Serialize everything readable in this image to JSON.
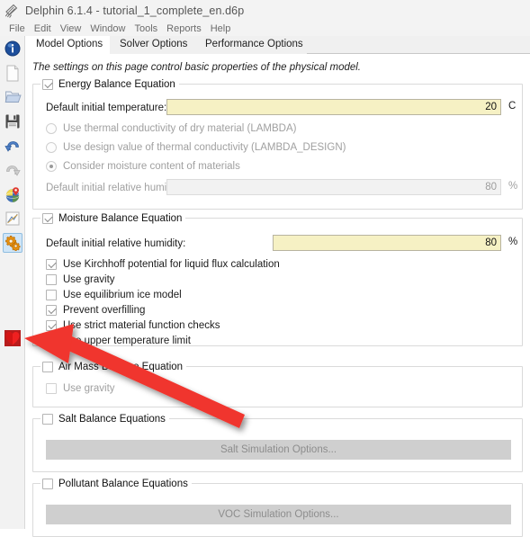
{
  "window": {
    "title": "Delphin 6.1.4 - tutorial_1_complete_en.d6p",
    "app_icon": "rain-drops-icon"
  },
  "menubar": {
    "items": [
      "File",
      "Edit",
      "View",
      "Window",
      "Tools",
      "Reports",
      "Help"
    ]
  },
  "sidebar": {
    "items": [
      {
        "name": "info-icon",
        "label": "Project Info"
      },
      {
        "name": "new-file-icon",
        "label": "New"
      },
      {
        "name": "open-folder-icon",
        "label": "Open"
      },
      {
        "name": "save-disk-icon",
        "label": "Save"
      },
      {
        "name": "undo-arrow-icon",
        "label": "Undo"
      },
      {
        "name": "redo-arrow-icon",
        "label": "Redo"
      },
      {
        "name": "globe-marker-icon",
        "label": "Climate"
      },
      {
        "name": "chart-icon",
        "label": "Outputs"
      },
      {
        "name": "gears-icon",
        "label": "Simulation Settings"
      },
      {
        "name": "red-heart-icon",
        "label": "Run Simulation"
      }
    ],
    "selected_index": 8
  },
  "tabs": [
    {
      "label": "Model Options",
      "active": true
    },
    {
      "label": "Solver Options",
      "active": false
    },
    {
      "label": "Performance Options",
      "active": false
    }
  ],
  "page": {
    "intro": "The settings on this page control basic properties of the physical model.",
    "groups": [
      {
        "id": "energy",
        "title": "Energy Balance Equation",
        "checked": true,
        "enabled": true,
        "temperature_label": "Default initial temperature:",
        "temperature_value": "20",
        "temperature_unit": "C",
        "radios": [
          {
            "label": "Use thermal conductivity of dry material (LAMBDA)",
            "selected": false
          },
          {
            "label": "Use design value of thermal conductivity (LAMBDA_DESIGN)",
            "selected": false
          },
          {
            "label": "Consider moisture content of materials",
            "selected": true
          }
        ],
        "rh_label": "Default initial relative humidity:",
        "rh_value": "80",
        "rh_unit": "%"
      },
      {
        "id": "moisture",
        "title": "Moisture Balance Equation",
        "checked": true,
        "enabled": true,
        "rh_label": "Default initial relative humidity:",
        "rh_value": "80",
        "rh_unit": "%",
        "checkboxes": [
          {
            "label": "Use Kirchhoff potential for liquid flux calculation",
            "checked": true
          },
          {
            "label": "Use gravity",
            "checked": false
          },
          {
            "label": "Use equilibrium ice model",
            "checked": false
          },
          {
            "label": "Prevent overfilling",
            "checked": true
          },
          {
            "label": "Use strict material function checks",
            "checked": true
          },
          {
            "label": "Use upper temperature limit",
            "checked": true
          }
        ]
      },
      {
        "id": "airmass",
        "title": "Air Mass Balance Equation",
        "checked": false,
        "enabled": true,
        "checkboxes": [
          {
            "label": "Use gravity",
            "checked": false,
            "dim": true
          }
        ]
      },
      {
        "id": "salt",
        "title": "Salt Balance Equations",
        "checked": false,
        "button_label": "Salt Simulation Options..."
      },
      {
        "id": "pollutant",
        "title": "Pollutant Balance Equations",
        "checked": false,
        "button_label": "VOC Simulation Options..."
      }
    ]
  },
  "annotation": {
    "type": "arrow",
    "color": "#f0362d",
    "points_to": "red-heart-icon"
  },
  "colors": {
    "titlebar_bg": "#f3f3f3",
    "field_bg": "#f6f1c4",
    "field_disabled_bg": "#f2f2f2",
    "tab_active_bg": "#ffffff",
    "sidebar_selection": "#cfe5f7",
    "button_bg": "#cfcfcf",
    "arrow": "#f0362d"
  }
}
